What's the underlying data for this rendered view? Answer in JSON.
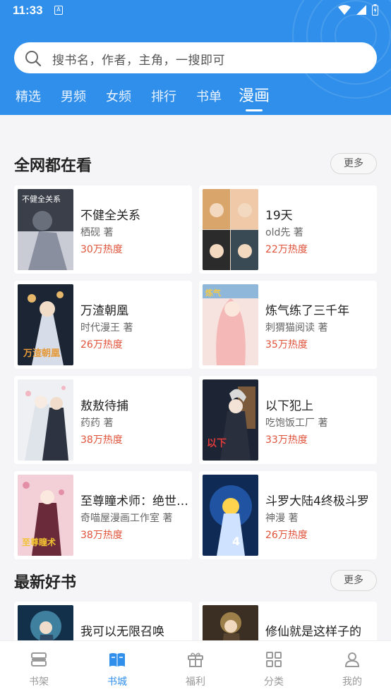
{
  "status_bar": {
    "time": "11:33",
    "notification_letter": "A"
  },
  "search": {
    "placeholder": "搜书名，作者，主角，一搜即可"
  },
  "tabs": [
    {
      "label": "精选"
    },
    {
      "label": "男频"
    },
    {
      "label": "女频"
    },
    {
      "label": "排行"
    },
    {
      "label": "书单"
    },
    {
      "label": "漫画",
      "active": true
    }
  ],
  "sections": [
    {
      "title": "全网都在看",
      "more_label": "更多",
      "books": [
        {
          "title": "不健全关系",
          "author": "栖砚 著",
          "heat": "30万热度"
        },
        {
          "title": "19天",
          "author": "old先 著",
          "heat": "22万热度"
        },
        {
          "title": "万渣朝凰",
          "author": "时代漫王 著",
          "heat": "26万热度"
        },
        {
          "title": "炼气练了三千年",
          "author": "刺猬猫阅读 著",
          "heat": "35万热度"
        },
        {
          "title": "敖敖待捕",
          "author": "药药 著",
          "heat": "38万热度"
        },
        {
          "title": "以下犯上",
          "author": "吃饱饭工厂 著",
          "heat": "33万热度"
        },
        {
          "title": "至尊瞳术师：绝世大小姐",
          "author": "奇喵屋漫画工作室 著",
          "heat": "38万热度"
        },
        {
          "title": "斗罗大陆4终极斗罗",
          "author": "神漫 著",
          "heat": "26万热度"
        }
      ]
    },
    {
      "title": "最新好书",
      "more_label": "更多",
      "books": [
        {
          "title": "我可以无限召唤"
        },
        {
          "title": "修仙就是这样子的"
        }
      ]
    }
  ],
  "bottom_nav": [
    {
      "label": "书架",
      "icon": "bookshelf-icon"
    },
    {
      "label": "书城",
      "icon": "bookstore-icon",
      "active": true
    },
    {
      "label": "福利",
      "icon": "gift-icon"
    },
    {
      "label": "分类",
      "icon": "category-grid-icon"
    },
    {
      "label": "我的",
      "icon": "profile-icon"
    }
  ],
  "colors": {
    "primary": "#2f8fea",
    "heat": "#e0523a",
    "page_bg": "#f5f5f7"
  }
}
